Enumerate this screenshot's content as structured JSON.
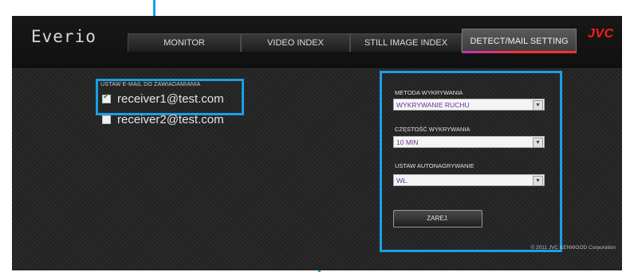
{
  "app": {
    "logo": "Everio",
    "brand": "JVC",
    "tabs": [
      "MONITOR",
      "VIDEO INDEX",
      "STILL IMAGE INDEX",
      "DETECT/MAIL SETTING"
    ],
    "active_tab": "DETECT/MAIL SETTING"
  },
  "mail": {
    "caption": "USTAW E-MAIL DO ZAWIADAMIANIA",
    "recipients": [
      {
        "address": "receiver1@test.com",
        "checked": true
      },
      {
        "address": "receiver2@test.com",
        "checked": false
      }
    ]
  },
  "settings": {
    "detection_method": {
      "label": "METODA WYKRYWANIA",
      "value": "WYKRYWANIE RUCHU"
    },
    "detection_frequency": {
      "label": "CZĘSTOŚĆ WYKRYWANIA",
      "value": "10 MIN"
    },
    "auto_record": {
      "label": "USTAW AUTONAGRYWANIE",
      "value": "WŁ."
    },
    "apply_label": "ZAREJ."
  },
  "footer": {
    "copyright": "© 2011 JVC KENWOOD Corporation"
  },
  "colors": {
    "callout": "#1a9fe6",
    "brand": "#ff1a1a"
  }
}
